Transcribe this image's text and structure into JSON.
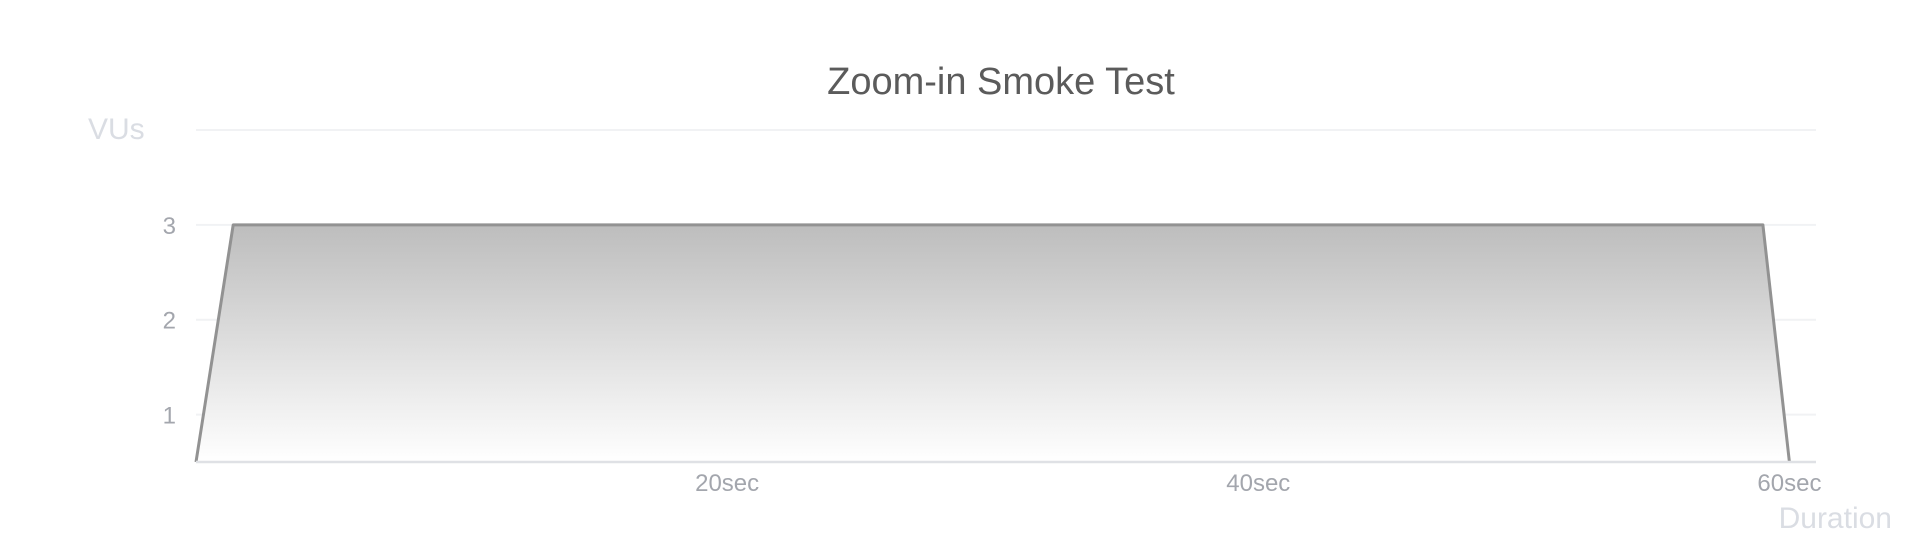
{
  "chart_data": {
    "type": "area",
    "title": "Zoom-in Smoke Test",
    "ylabel": "VUs",
    "xlabel": "Duration",
    "x_unit": "sec",
    "xlim": [
      0,
      61
    ],
    "ylim": [
      0.5,
      4
    ],
    "x_ticks": [
      {
        "value": 20,
        "label": "20sec"
      },
      {
        "value": 40,
        "label": "40sec"
      },
      {
        "value": 60,
        "label": "60sec"
      }
    ],
    "y_ticks": [
      {
        "value": 1,
        "label": "1"
      },
      {
        "value": 2,
        "label": "2"
      },
      {
        "value": 3,
        "label": "3"
      }
    ],
    "series": [
      {
        "values": [
          {
            "x": 0,
            "y": 0.5
          },
          {
            "x": 1.4,
            "y": 3
          },
          {
            "x": 59,
            "y": 3
          },
          {
            "x": 60,
            "y": 0.5
          }
        ]
      }
    ],
    "grid": true,
    "legend": "none",
    "colors": {
      "line": "#929292",
      "fill_top": "#bdbdbd",
      "fill_bottom": "#ffffff",
      "grid": "#f1f2f4",
      "title": "#5b5b5b",
      "tick": "#a3a6ad",
      "axis_name": "#dadde3"
    }
  }
}
